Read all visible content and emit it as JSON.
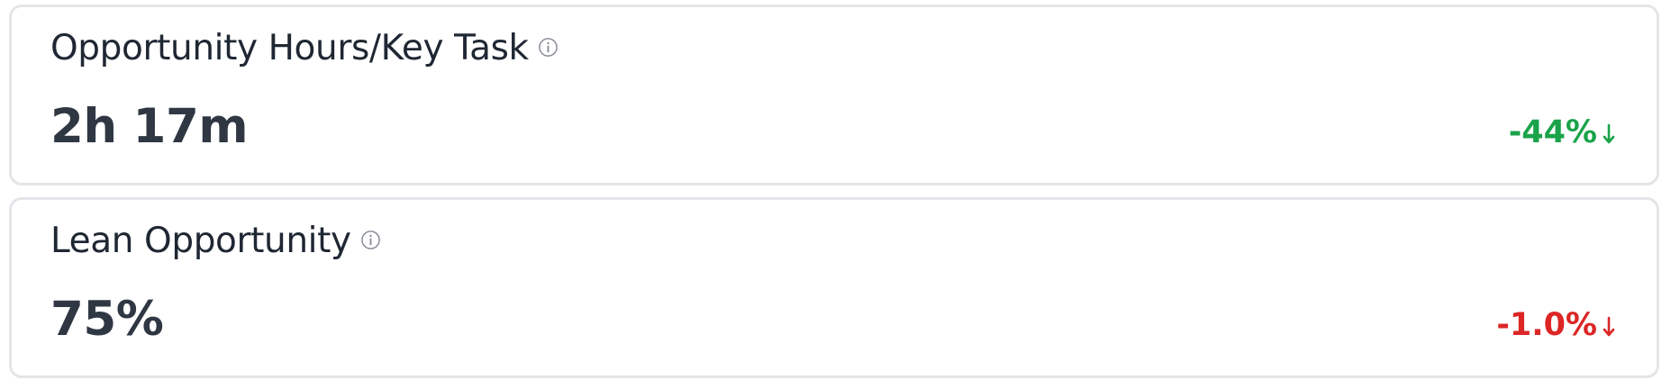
{
  "metrics": [
    {
      "title": "Opportunity Hours/Key Task",
      "value": "2h 17m",
      "change": "-44%",
      "change_color": "#1aa34a",
      "trend_icon": "arrow-down-icon",
      "info_icon": "info-icon"
    },
    {
      "title": "Lean Opportunity",
      "value": "75%",
      "change": "-1.0%",
      "change_color": "#dc2626",
      "trend_icon": "arrow-down-icon",
      "info_icon": "info-icon"
    }
  ]
}
